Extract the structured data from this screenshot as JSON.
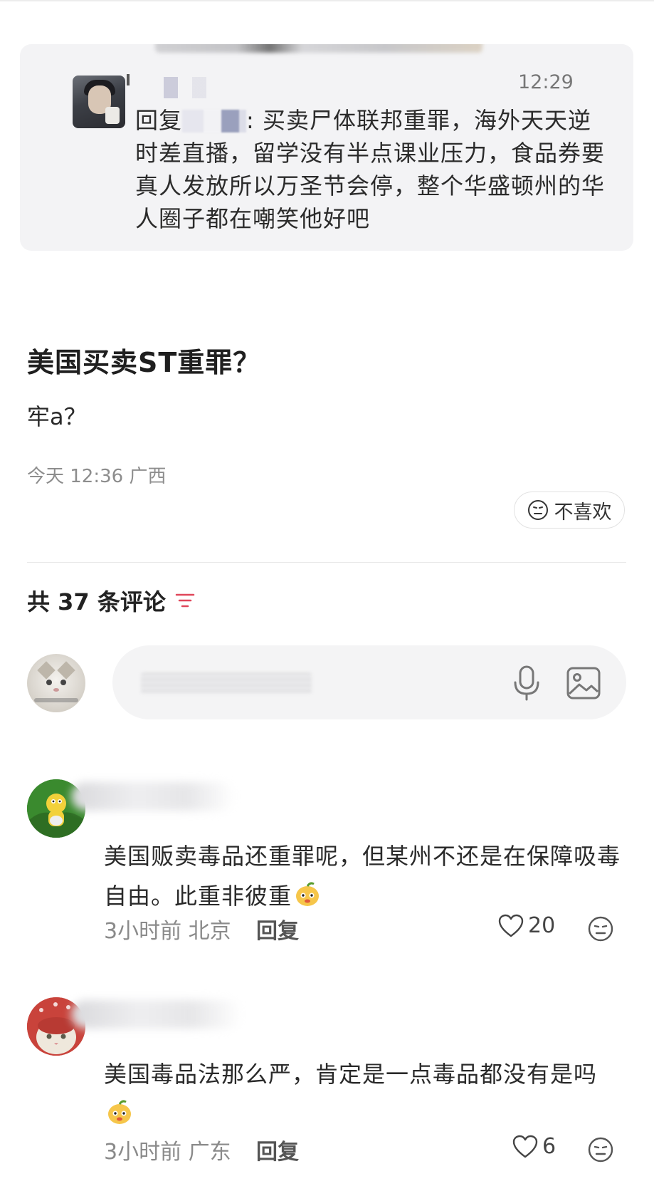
{
  "quoted_message": {
    "time": "12:29",
    "reply_prefix": "回复",
    "text": ": 买卖尸体联邦重罪，海外天天逆时差直播，留学没有半点课业压力，食品券要真人发放所以万圣节会停，整个华盛顿州的华人圈子都在嘲笑他好吧"
  },
  "post": {
    "title": "美国买卖ST重罪？",
    "body": "牢a？",
    "meta": "今天 12:36 广西",
    "dislike_label": "不喜欢"
  },
  "comments_header": {
    "label": "共 37 条评论"
  },
  "comment_input": {
    "icons": [
      "microphone-icon",
      "image-icon"
    ]
  },
  "comments": [
    {
      "text": "美国贩卖毒品还重罪呢，但某州不还是在保障吸毒自由。此重非彼重",
      "time_location": "3小时前 北京",
      "reply_label": "回复",
      "likes": "20"
    },
    {
      "text": "美国毒品法那么严，肯定是一点毒品都没有是吗",
      "time_location": "3小时前 广东",
      "reply_label": "回复",
      "likes": "6"
    }
  ],
  "colors": {
    "accent": "#e0475a",
    "card_bg": "#f3f3f5",
    "muted_text": "#8a8a8a"
  }
}
